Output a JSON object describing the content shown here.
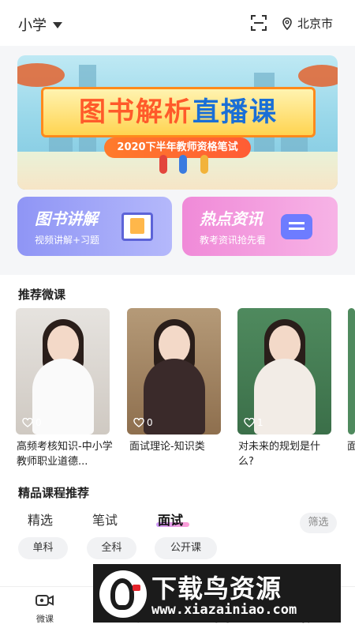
{
  "topbar": {
    "level": "小学",
    "city": "北京市"
  },
  "banner": {
    "title_part1": "图书解析",
    "title_part2": "直播课",
    "subtitle": "2020下半年教师资格笔试"
  },
  "features": [
    {
      "title": "图书讲解",
      "subtitle": "视频讲解+习题"
    },
    {
      "title": "热点资讯",
      "subtitle": "教考资讯抢先看"
    }
  ],
  "micro": {
    "heading": "推荐微课",
    "items": [
      {
        "title": "高频考核知识-中小学教师职业道德...",
        "likes": "0"
      },
      {
        "title": "面试理论-知识类",
        "likes": "0"
      },
      {
        "title": "对未来的规划是什么?",
        "likes": "1"
      },
      {
        "title": "面",
        "likes": ""
      }
    ]
  },
  "courses": {
    "heading": "精品课程推荐",
    "tabs": [
      "精选",
      "笔试",
      "面试"
    ],
    "active_tab": "面试",
    "filter": "筛选",
    "chips": [
      "单科",
      "全科",
      "公开课"
    ]
  },
  "nav": [
    {
      "label": "微课"
    },
    {
      "label": "选课"
    },
    {
      "label": "学习"
    },
    {
      "label": "我的"
    }
  ],
  "watermark": {
    "brand": "下载鸟资源",
    "url": "www.xiazainiao.com"
  },
  "colors": {
    "card_left": "#8f95f5",
    "card_right": "#f08ad8",
    "tab_accent": "#b56cf0"
  }
}
